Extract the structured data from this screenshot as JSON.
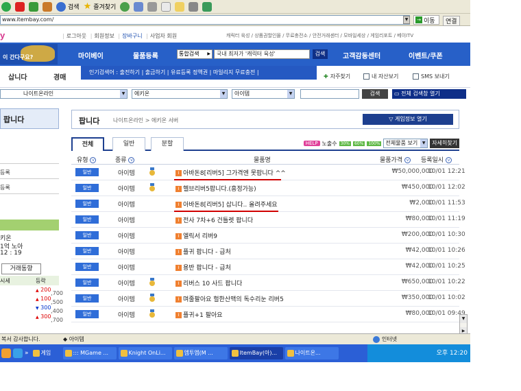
{
  "browser": {
    "toolbar": {
      "search": "검색",
      "favorites": "즐겨찾기"
    },
    "address": "www.itembay.com/",
    "go": "이동",
    "links": "연결"
  },
  "site": {
    "logo": "y",
    "user_links": [
      "로그아웃",
      "회원정보",
      "장바구니",
      "사업자 회원"
    ],
    "service_links": "캐릭터 육성 / 상품권할인몰 / 무료충전소 / 안전거래센터 / 모바일세상 / 게임리포트 / 베이ITV",
    "service_highlight": "안전거래센터",
    "banner_text": "이 간다구요?",
    "nav": [
      "마이베이",
      "물품등록",
      "고객감동센터",
      "이벤트/쿠폰"
    ],
    "search_type": "통합검색",
    "search_value": "국내 최저가 '캐릭터 육성'",
    "search_btn": "검색",
    "sell_tab": "삽니다",
    "auction_tab": "경매",
    "popular": "인기검색어 : 출전하기 | 출금하기 | 유료등록 정액권 | 마일리지 무료충전 |",
    "right_links": [
      "자주찾기",
      "내 자산보기",
      "SMS 보내기"
    ],
    "filters": {
      "game": "나이트온라인",
      "server": "에키온",
      "category": "아이템"
    },
    "filter_search_btn": "검색",
    "open_search_btn": "전체 검색창 열기"
  },
  "sidebar": {
    "title": "팝니다",
    "items": [
      "등록",
      "등록"
    ],
    "info_lines": [
      "키온",
      "1억 노아",
      "12 : 19"
    ],
    "trend_tab": "거래동향",
    "trend_headers": [
      "시세",
      "등락"
    ],
    "trend_rows": [
      {
        "price": ",700",
        "change": "200",
        "dir": "up"
      },
      {
        "price": ",500",
        "change": "100",
        "dir": "up"
      },
      {
        "price": ",400",
        "change": "300",
        "dir": "down"
      },
      {
        "price": ",700",
        "change": "300",
        "dir": "up"
      }
    ]
  },
  "content": {
    "title": "팝니다",
    "breadcrumb": "나이트온라인 > 에키온 서버",
    "game_info_btn": "게임정보 열기",
    "tabs": [
      "전체",
      "일반",
      "분할"
    ],
    "help": "HELP",
    "exposure": "노출수",
    "pct_badges": [
      "30%",
      "60%",
      "100%"
    ],
    "view_select": "전체물품 보기",
    "detail_btn": "자세히찾기",
    "headers": {
      "type": "유형",
      "category": "종류",
      "name": "물품명",
      "price": "물품가격",
      "date": "등록일시"
    },
    "rows": [
      {
        "type": "일반",
        "category": "아이템",
        "medal": true,
        "name": "아바돈8[리버5] 그가격엔 못팝니다 ^^",
        "price": "₩50,000,000",
        "date": "10/01 12:21",
        "underline": true
      },
      {
        "type": "일반",
        "category": "아이템",
        "medal": true,
        "name": "헬브리버5팝니다.(흥정가능)",
        "price": "₩450,000",
        "date": "10/01 12:02",
        "underline": false
      },
      {
        "type": "일반",
        "category": "아이템",
        "medal": false,
        "name": "아바돈8[리버5] 삽니다.. 올려주세요",
        "price": "₩2,000",
        "date": "10/01 11:53",
        "underline": true
      },
      {
        "type": "일반",
        "category": "아이템",
        "medal": false,
        "name": "전사 7차+6 건틀렛 팝니다",
        "price": "₩80,000",
        "date": "10/01 11:19",
        "underline": false
      },
      {
        "type": "일반",
        "category": "아이템",
        "medal": false,
        "name": "엘릭서 리버9",
        "price": "₩200,000",
        "date": "10/01 10:30",
        "underline": false
      },
      {
        "type": "일반",
        "category": "아이템",
        "medal": false,
        "name": "플귀 팝니다 - 급처",
        "price": "₩42,000",
        "date": "10/01 10:26",
        "underline": false
      },
      {
        "type": "일반",
        "category": "아이템",
        "medal": false,
        "name": "용반 팝니다 - 급처",
        "price": "₩42,000",
        "date": "10/01 10:25",
        "underline": false
      },
      {
        "type": "일반",
        "category": "아이템",
        "medal": true,
        "name": "리버스 10 사드 팝니다",
        "price": "₩650,000",
        "date": "10/01 10:22",
        "underline": false
      },
      {
        "type": "일반",
        "category": "아이템",
        "medal": true,
        "name": "며줄팔아요 헐한산맥의 독수리눈 리버5",
        "price": "₩350,000",
        "date": "10/01 10:02",
        "underline": false
      },
      {
        "type": "일반",
        "category": "아이템",
        "medal": true,
        "name": "플귀+1 팔아요",
        "price": "₩80,000",
        "date": "10/01 09:49",
        "underline": false
      }
    ]
  },
  "statusbar": {
    "left": "복서 감사합니다.",
    "item": "◆ 아이템",
    "zone": "인터넷"
  },
  "taskbar": {
    "items": [
      "게임",
      "::: MGame ...",
      "Knight OnLi...",
      "엠투엠(M ...",
      "ItemBay(아)...",
      "나이트온..."
    ],
    "active_index": 4,
    "clock": "오후 12:20"
  }
}
